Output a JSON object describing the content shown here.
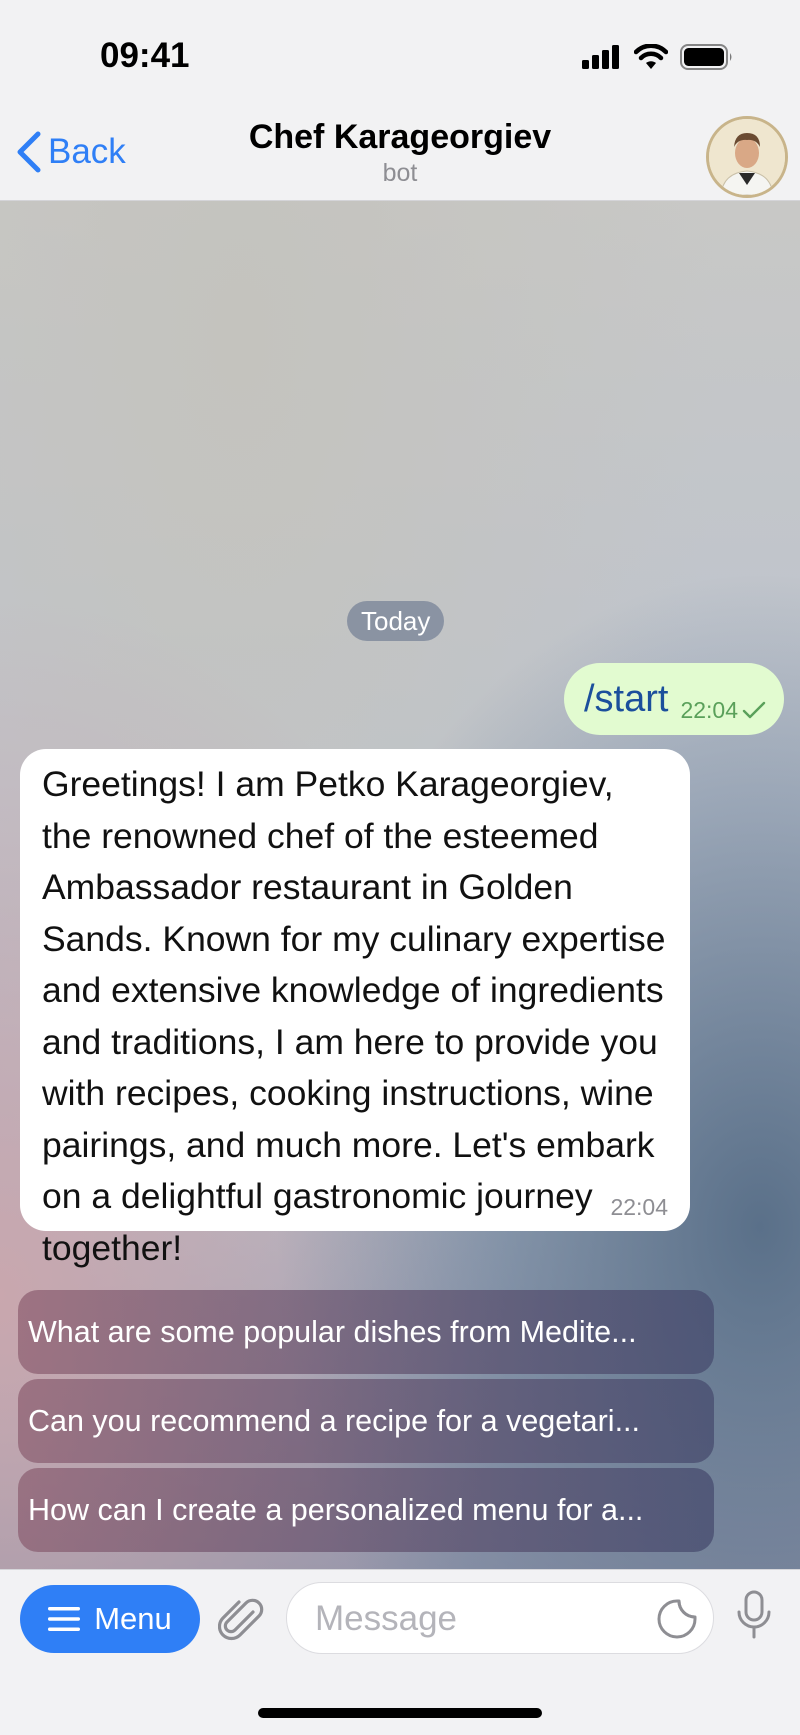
{
  "status_bar": {
    "time": "09:41"
  },
  "header": {
    "back_label": "Back",
    "title": "Chef Karageorgiev",
    "subtitle": "bot"
  },
  "chat": {
    "date_label": "Today",
    "outgoing": {
      "text": "/start",
      "time": "22:04",
      "status": "read-check"
    },
    "incoming": {
      "text": "Greetings! I am Petko Karageorgiev, the renowned chef of the esteemed Ambassador restaurant in Golden Sands. Known for my culinary expertise and extensive knowledge of ingredients and traditions, I am here to provide you with recipes, cooking instructions, wine pairings, and much more. Let's embark on a delightful gastronomic journey together!",
      "time": "22:04"
    },
    "quick_replies": [
      "What are some popular dishes from Medite...",
      "Can you recommend a recipe for a vegetari...",
      "How can I create a personalized menu for a..."
    ]
  },
  "input_bar": {
    "menu_label": "Menu",
    "message_placeholder": "Message"
  },
  "colors": {
    "accent": "#2f7ff6",
    "outgoing_bubble": "#e2fbd0",
    "incoming_bubble": "#ffffff"
  }
}
